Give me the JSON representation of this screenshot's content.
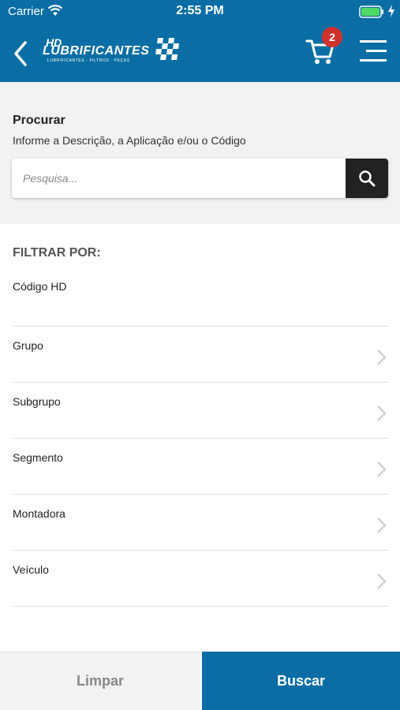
{
  "status_bar": {
    "carrier": "Carrier",
    "time": "2:55 PM",
    "icons": [
      "wifi-icon",
      "battery-icon",
      "charging-bolt-icon"
    ]
  },
  "header": {
    "logo": {
      "hd": "HD",
      "brand": "LUBRIFICANTES",
      "tagline": "LUBRIFICANTES · FILTROS · PEÇAS"
    },
    "cart_count": "2",
    "colors": {
      "bar": "#0a6ea5",
      "badge": "#d0312d"
    },
    "icons": [
      "back-icon",
      "cart-icon",
      "menu-icon"
    ]
  },
  "search": {
    "title": "Procurar",
    "hint": "Informe a Descrição, a Aplicação e/ou o Código",
    "placeholder": "Pesquisa...",
    "button_icon": "search-icon"
  },
  "filters": {
    "title": "FILTRAR POR:",
    "codigo_label": "Código HD",
    "items": [
      {
        "label": "Grupo"
      },
      {
        "label": "Subgrupo"
      },
      {
        "label": "Segmento"
      },
      {
        "label": "Montadora"
      },
      {
        "label": "Veículo"
      }
    ]
  },
  "actions": {
    "clear": "Limpar",
    "search": "Buscar"
  }
}
